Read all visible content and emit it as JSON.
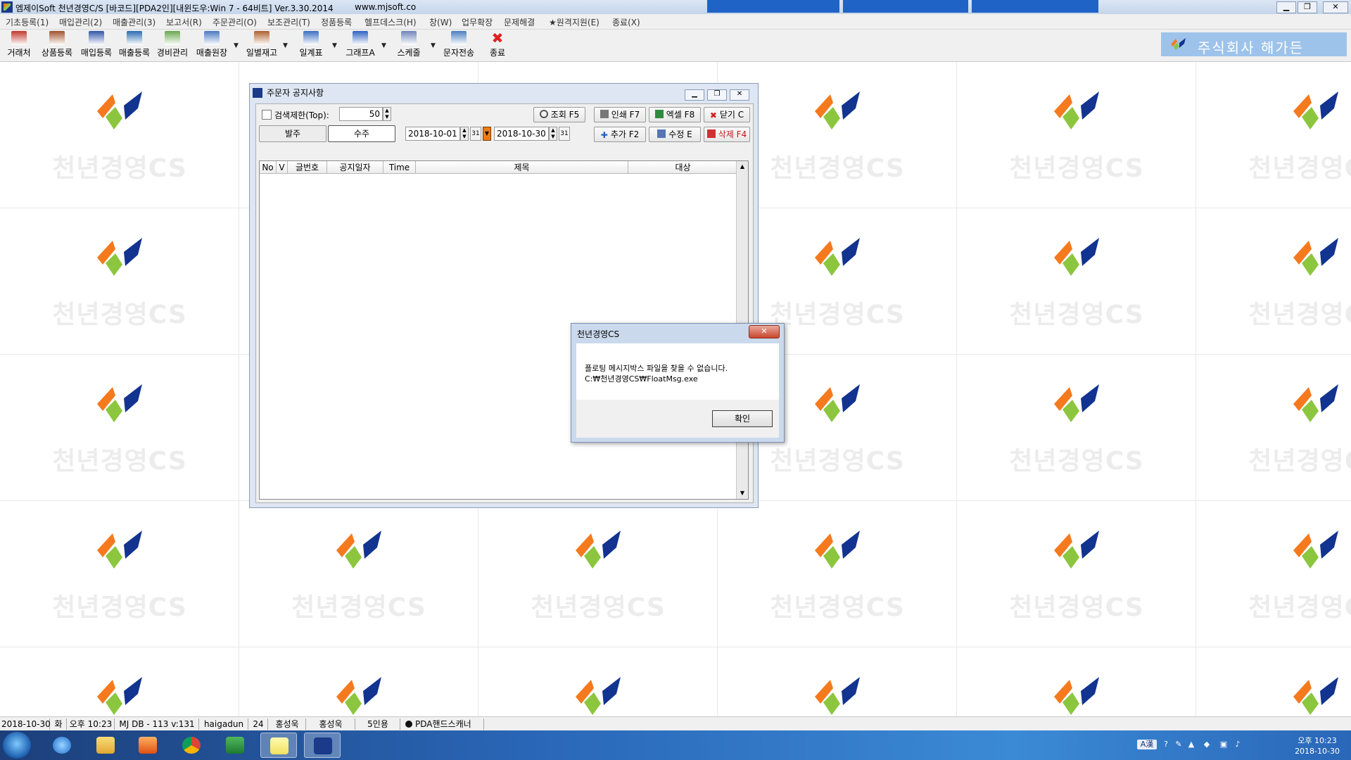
{
  "window": {
    "title": "엠제이Soft 천년경영C/S [바코드][PDA2인][내윈도우:Win 7 - 64비트] Ver.3.30.2014",
    "url": "www.mjsoft.co"
  },
  "menu": [
    "기초등록(1)",
    "매입관리(2)",
    "매출관리(3)",
    "보고서(R)",
    "주문관리(O)",
    "보조관리(T)",
    "정품등록",
    "헬프데스크(H)",
    "창(W)",
    "업무확장",
    "문제해결",
    "★원격지원(E)",
    "종료(X)"
  ],
  "toolbar": [
    {
      "label": "거래처",
      "icon": "customer-icon",
      "color": "#c0392b"
    },
    {
      "label": "상품등록",
      "icon": "product-box-icon",
      "color": "#a0522d"
    },
    {
      "label": "매입등록",
      "icon": "purchase-icon",
      "color": "#3355aa"
    },
    {
      "label": "매출등록",
      "icon": "sales-icon",
      "color": "#2b6cb0"
    },
    {
      "label": "경비관리",
      "icon": "expense-icon",
      "color": "#6aa84f"
    },
    {
      "label": "매출원장",
      "icon": "ledger-icon",
      "color": "#4a78c2"
    },
    {
      "label": "일별재고",
      "icon": "stock-icon",
      "color": "#b06030"
    },
    {
      "label": "일계표",
      "icon": "daily-report-icon",
      "color": "#3a6fbf"
    },
    {
      "label": "그래프A",
      "icon": "graph-icon",
      "color": "#2f62c4"
    },
    {
      "label": "스케줄",
      "icon": "schedule-icon",
      "color": "#6f86b8"
    },
    {
      "label": "문자전송",
      "icon": "sms-icon",
      "color": "#4a7fc0"
    },
    {
      "label": "종료",
      "icon": "exit-x-icon",
      "color": "#e02020"
    }
  ],
  "company": {
    "name": "주식회사 해가든"
  },
  "background": {
    "watermark": "천년경영CS"
  },
  "child_window": {
    "title": "주문자 공지사항",
    "search_limit_label": "검색제한(Top):",
    "search_limit_value": "50",
    "tab_order": "발주",
    "tab_receive": "수주",
    "date_from": "2018-10-01",
    "date_to": "2018-10-30",
    "cal_label": "31",
    "buttons": {
      "query": "조회 F5",
      "print": "인쇄 F7",
      "excel": "엑셀 F8",
      "close": "닫기 C",
      "add": "추가 F2",
      "edit": "수정 E",
      "delete": "삭제 F4"
    },
    "columns": [
      "No",
      "V",
      "글번호",
      "공지일자",
      "Time",
      "제목",
      "대상"
    ]
  },
  "dialog": {
    "title": "천년경영CS",
    "message_line1": "플로팅 메시지박스 파일을 찾을 수 없습니다.",
    "message_line2": "C:₩천년경영CS₩FloatMsg.exe",
    "ok": "확인"
  },
  "statusbar": [
    "2018-10-30",
    "화",
    "오후 10:23",
    "MJ DB - 113 v:131",
    "haigadun",
    "24",
    "홍성욱",
    "홍성욱",
    "5인용",
    "PDA핸드스캐너"
  ],
  "taskbar": {
    "clock_time": "오후 10:23",
    "clock_date": "2018-10-30",
    "ime": "A漢"
  }
}
